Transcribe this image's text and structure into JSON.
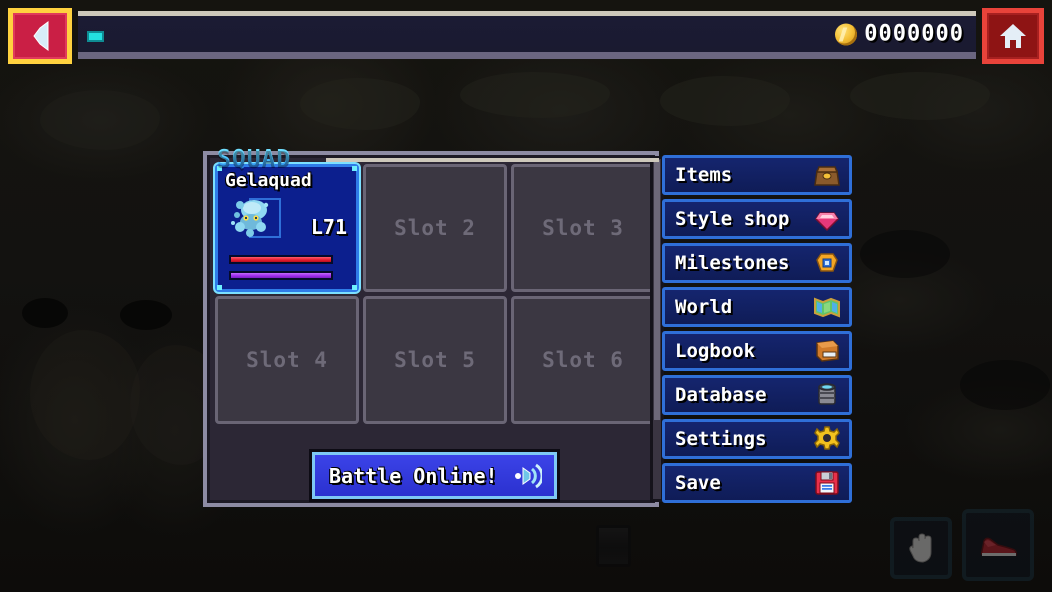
{
  "topbar": {
    "back_button": "back",
    "home_button": "home",
    "progress_indicator": "progress-pill",
    "currency": {
      "icon": "coin-icon",
      "amount": "0000000"
    }
  },
  "squad": {
    "title": "SQUAD",
    "slots": [
      {
        "index": 1,
        "filled": true,
        "name": "Gelaquad",
        "level": "L71",
        "hp_percent": 100,
        "mp_percent": 100,
        "sprite": "gelaquad-sprite"
      },
      {
        "index": 2,
        "filled": false,
        "label": "Slot 2"
      },
      {
        "index": 3,
        "filled": false,
        "label": "Slot 3"
      },
      {
        "index": 4,
        "filled": false,
        "label": "Slot 4"
      },
      {
        "index": 5,
        "filled": false,
        "label": "Slot 5"
      },
      {
        "index": 6,
        "filled": false,
        "label": "Slot 6"
      }
    ],
    "battle_button": {
      "label": "Battle Online!",
      "icon": "broadcast-icon"
    }
  },
  "menu": {
    "items": [
      {
        "label": "Items",
        "icon": "bag-icon"
      },
      {
        "label": "Style shop",
        "icon": "gem-icon"
      },
      {
        "label": "Milestones",
        "icon": "medal-icon"
      },
      {
        "label": "World",
        "icon": "map-icon"
      },
      {
        "label": "Logbook",
        "icon": "book-icon"
      },
      {
        "label": "Database",
        "icon": "server-icon"
      },
      {
        "label": "Settings",
        "icon": "gear-icon"
      },
      {
        "label": "Save",
        "icon": "floppy-disk-icon"
      }
    ]
  },
  "hud": {
    "hand_button": "hand-icon",
    "run_button": "shoe-icon"
  },
  "colors": {
    "accent_cyan": "#6ef0ff",
    "panel_bg": "#2c2735",
    "panel_border": "#8d8ba3",
    "slot_bg": "#3b3742",
    "slot_border": "#6a6575",
    "menu_bg": "#15256e",
    "menu_border": "#2f6fd8",
    "card_bg": "#0c1f8e",
    "hp_bar": "#e41b2d",
    "mp_bar": "#9a2ae8",
    "battle_blue": "#3b43e8",
    "back_red": "#ca1f45",
    "back_gold": "#ffd23f",
    "home_red": "#8e1414",
    "coin_gold": "#f5c138",
    "topbar_bg": "#1b1b33"
  }
}
